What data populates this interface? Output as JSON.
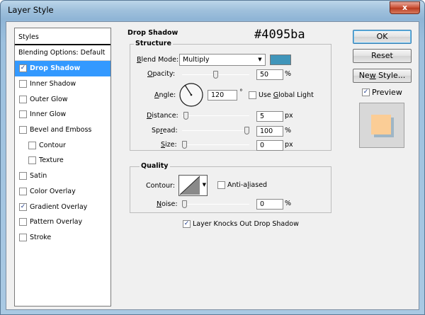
{
  "window": {
    "title": "Layer Style",
    "close_glyph": "x"
  },
  "styles_panel": {
    "header": "Styles",
    "blending_options": "Blending Options: Default",
    "items": [
      {
        "label": "Drop Shadow",
        "checked": true,
        "selected": true,
        "indent": false
      },
      {
        "label": "Inner Shadow",
        "checked": false,
        "selected": false,
        "indent": false
      },
      {
        "label": "Outer Glow",
        "checked": false,
        "selected": false,
        "indent": false
      },
      {
        "label": "Inner Glow",
        "checked": false,
        "selected": false,
        "indent": false
      },
      {
        "label": "Bevel and Emboss",
        "checked": false,
        "selected": false,
        "indent": false
      },
      {
        "label": "Contour",
        "checked": false,
        "selected": false,
        "indent": true
      },
      {
        "label": "Texture",
        "checked": false,
        "selected": false,
        "indent": true
      },
      {
        "label": "Satin",
        "checked": false,
        "selected": false,
        "indent": false
      },
      {
        "label": "Color Overlay",
        "checked": false,
        "selected": false,
        "indent": false
      },
      {
        "label": "Gradient Overlay",
        "checked": true,
        "selected": false,
        "indent": false
      },
      {
        "label": "Pattern Overlay",
        "checked": false,
        "selected": false,
        "indent": false
      },
      {
        "label": "Stroke",
        "checked": false,
        "selected": false,
        "indent": false
      }
    ]
  },
  "drop_shadow": {
    "section_title": "Drop Shadow",
    "annotation": "#4095ba",
    "structure": {
      "title": "Structure",
      "blend_mode_label_u": "B",
      "blend_mode_label_rest": "lend Mode:",
      "blend_mode_value": "Multiply",
      "shadow_color": "#4095ba",
      "opacity_label_u": "O",
      "opacity_label_rest": "pacity:",
      "opacity_value": "50",
      "opacity_unit": "%",
      "opacity_level": 50,
      "angle_label_u": "A",
      "angle_label_rest": "ngle:",
      "angle_value": "120",
      "angle_unit": "°",
      "use_global_light_label_u": "G",
      "use_global_light_label_pre": "Use ",
      "use_global_light_label_rest": "lobal Light",
      "use_global_light_checked": false,
      "distance_label_u": "D",
      "distance_label_rest": "istance:",
      "distance_value": "5",
      "distance_unit": "px",
      "distance_level": 0.02,
      "spread_label_pre": "Sp",
      "spread_label_u": "r",
      "spread_label_rest": "ead:",
      "spread_value": "100",
      "spread_unit": "%",
      "spread_level": 100,
      "size_label_u": "S",
      "size_label_rest": "ize:",
      "size_value": "0",
      "size_unit": "px",
      "size_level": 0
    },
    "quality": {
      "title": "Quality",
      "contour_label": "Contour:",
      "anti_aliased_label_pre": "Anti-a",
      "anti_aliased_label_u": "l",
      "anti_aliased_label_rest": "iased",
      "anti_aliased_checked": false,
      "noise_label_u": "N",
      "noise_label_rest": "oise:",
      "noise_value": "0",
      "noise_unit": "%",
      "noise_level": 0
    },
    "knockout_label": "Layer Knocks Out Drop Shadow",
    "knockout_checked": true
  },
  "buttons": {
    "ok": "OK",
    "reset": "Reset",
    "new_style_pre": "Ne",
    "new_style_u": "w",
    "new_style_rest": " Style...",
    "preview_label": "Preview",
    "preview_checked": true
  },
  "preview_colors": {
    "fill": "#fbcd96",
    "shadow": "#9fb6c6",
    "background": "#d8d8d8"
  }
}
